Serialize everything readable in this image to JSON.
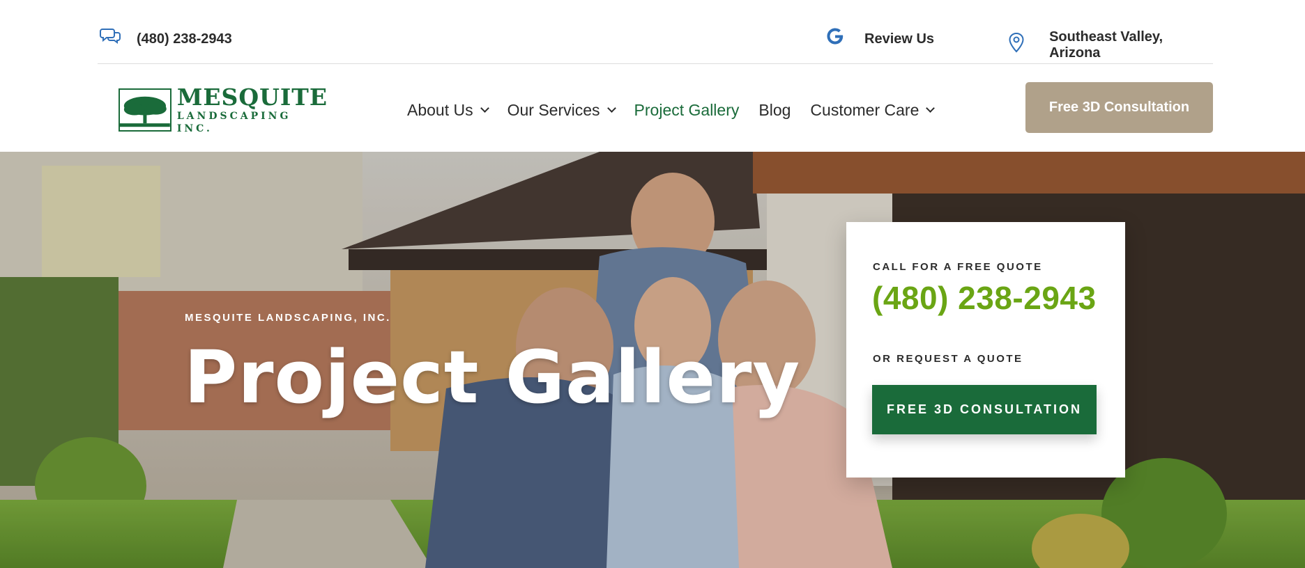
{
  "topbar": {
    "phone": "(480) 238-2943",
    "review": "Review Us",
    "location": "Southeast Valley, Arizona",
    "icons": [
      "chat-icon",
      "google-icon",
      "location-pin-icon"
    ]
  },
  "logo": {
    "name": "MESQUITE",
    "sub": "LANDSCAPING INC."
  },
  "nav": {
    "items": [
      {
        "label": "About Us",
        "dropdown": true
      },
      {
        "label": "Our Services",
        "dropdown": true
      },
      {
        "label": "Project Gallery",
        "dropdown": false,
        "active": true
      },
      {
        "label": "Blog",
        "dropdown": false
      },
      {
        "label": "Customer Care",
        "dropdown": true
      }
    ],
    "cta": "Free 3D Consultation"
  },
  "hero": {
    "eyebrow": "MESQUITE LANDSCAPING, INC.",
    "title": "Project Gallery"
  },
  "quote_card": {
    "label1": "CALL FOR A FREE QUOTE",
    "phone": "(480) 238-2943",
    "label2": "OR REQUEST A QUOTE",
    "button": "FREE 3D CONSULTATION"
  },
  "colors": {
    "brand_green": "#1a6b3a",
    "phone_green": "#6aa514",
    "tan": "#b0a18a",
    "icon_blue": "#2f6fb8"
  }
}
